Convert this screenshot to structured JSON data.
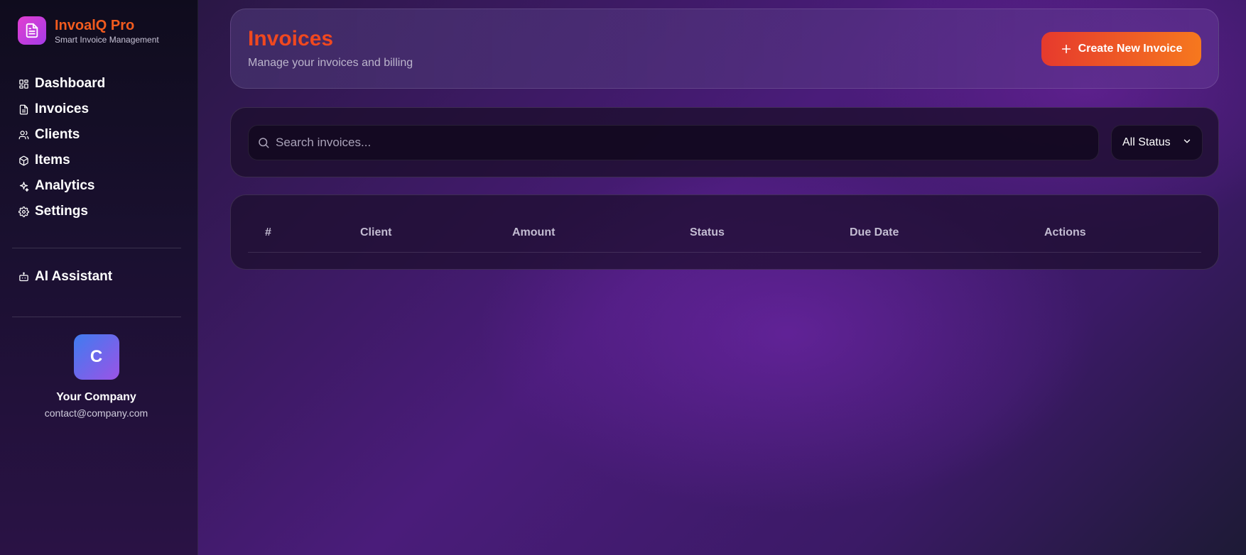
{
  "brand": {
    "name": "InvoalQ Pro",
    "tagline": "Smart Invoice Management"
  },
  "sidebar": {
    "items": [
      {
        "label": "Dashboard",
        "icon": "dashboard-grid-icon"
      },
      {
        "label": "Invoices",
        "icon": "file-text-icon"
      },
      {
        "label": "Clients",
        "icon": "users-icon"
      },
      {
        "label": "Items",
        "icon": "package-icon"
      },
      {
        "label": "Analytics",
        "icon": "sparkles-icon"
      },
      {
        "label": "Settings",
        "icon": "gear-icon"
      }
    ],
    "assistant": {
      "label": "AI Assistant",
      "icon": "bot-icon"
    }
  },
  "company": {
    "initial": "C",
    "name": "Your Company",
    "email": "contact@company.com"
  },
  "header": {
    "title": "Invoices",
    "subtitle": "Manage your invoices and billing",
    "create_label": "Create New Invoice"
  },
  "filters": {
    "search_placeholder": "Search invoices...",
    "status_value": "All Status"
  },
  "table": {
    "columns": [
      "#",
      "Client",
      "Amount",
      "Status",
      "Due Date",
      "Actions"
    ],
    "rows": []
  },
  "colors": {
    "accent": "#f0481f",
    "button_start": "#e63a2d",
    "button_end": "#f6781e",
    "brand_logo": "#c13edc"
  }
}
